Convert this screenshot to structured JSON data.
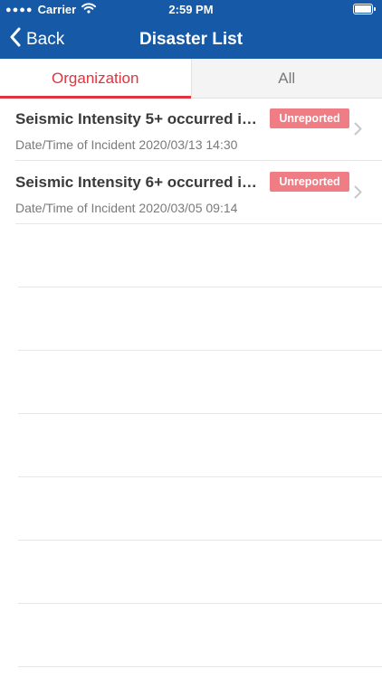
{
  "status_bar": {
    "carrier": "Carrier",
    "time": "2:59 PM"
  },
  "nav": {
    "back_label": "Back",
    "title": "Disaster List"
  },
  "tabs": [
    {
      "label": "Organization",
      "active": true
    },
    {
      "label": "All",
      "active": false
    }
  ],
  "items": [
    {
      "title": "Seismic Intensity 5+ occurred in...",
      "subtitle": "Date/Time of Incident 2020/03/13 14:30",
      "badge": "Unreported"
    },
    {
      "title": "Seismic Intensity 6+ occurred in...",
      "subtitle": "Date/Time of Incident 2020/03/05 09:14",
      "badge": "Unreported"
    }
  ],
  "colors": {
    "nav_background": "#1659a6",
    "accent": "#e0343f",
    "badge_background": "#f07c84"
  },
  "icons": {
    "back": "chevron-left-icon",
    "row_disclosure": "chevron-right-icon",
    "wifi": "wifi-icon",
    "battery": "battery-icon",
    "signal": "signal-dots-icon"
  }
}
